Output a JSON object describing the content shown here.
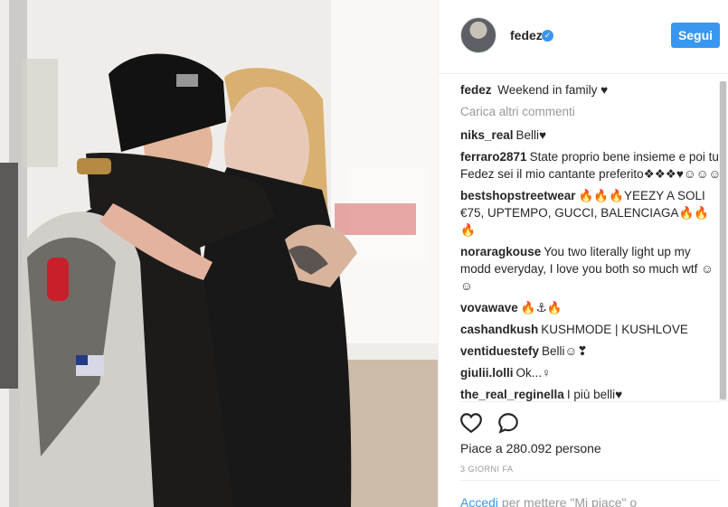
{
  "post": {
    "username": "fedez",
    "verified_icon": "verified-badge-icon",
    "follow_label": "Segui",
    "caption_user": "fedez",
    "caption_text": "Weekend in family ♥",
    "load_more": "Carica altri commenti",
    "comments": [
      {
        "user": "niks_real",
        "text": "Belli♥"
      },
      {
        "user": "ferraro2871",
        "text": "State proprio bene insieme e poi tu Fedez sei il mio cantante preferito❖❖❖♥☺☺☺"
      },
      {
        "user": "bestshopstreetwear",
        "text": "🔥🔥🔥YEEZY A SOLI €75, UPTEMPO, GUCCI, BALENCIAGA🔥🔥🔥"
      },
      {
        "user": "noraragkouse",
        "text": "You two literally light up my modd everyday, I love you both so much wtf ☺☺"
      },
      {
        "user": "vovawave",
        "text": "🔥⚓🔥"
      },
      {
        "user": "cashandkush",
        "text": "KUSHMODE | KUSHLOVE"
      },
      {
        "user": "ventiduestefy",
        "text": "Belli☺❣"
      },
      {
        "user": "giulii.lolli",
        "text": "Ok...♀"
      },
      {
        "user": "the_real_reginella",
        "text": "I più belli♥"
      }
    ],
    "like_icon": "heart-icon",
    "comment_icon": "speech-bubble-icon",
    "likes_text": "Piace a 280.092 persone",
    "time_text": "3 GIORNI FA",
    "login_link": "Accedi",
    "login_text": " per mettere \"Mi piace\" o"
  }
}
